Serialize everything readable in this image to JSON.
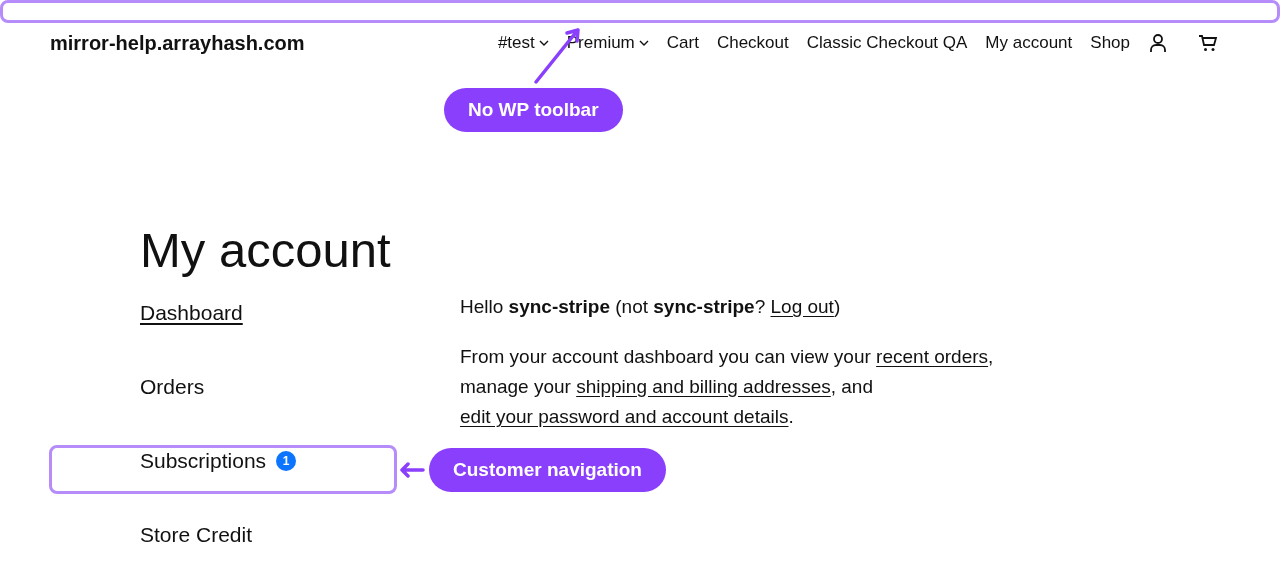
{
  "site_title": "mirror-help.arrayhash.com",
  "header_nav": [
    {
      "label": "#test",
      "kind": "dropdown"
    },
    {
      "label": "Premium",
      "kind": "dropdown"
    },
    {
      "label": "Cart",
      "kind": "link"
    },
    {
      "label": "Checkout",
      "kind": "link"
    },
    {
      "label": "Classic Checkout QA",
      "kind": "link"
    },
    {
      "label": "My account",
      "kind": "link"
    },
    {
      "label": "Shop",
      "kind": "link"
    }
  ],
  "page_title": "My account",
  "account_nav": [
    {
      "label": "Dashboard",
      "selected": true
    },
    {
      "label": "Orders",
      "selected": false
    },
    {
      "label": "Subscriptions",
      "selected": false,
      "badge": "1"
    },
    {
      "label": "Store Credit",
      "selected": false
    }
  ],
  "greeting": [
    {
      "text": "Hello ",
      "kind": "plain"
    },
    {
      "text": "sync-stripe",
      "kind": "bold"
    },
    {
      "text": " (not ",
      "kind": "plain"
    },
    {
      "text": "sync-stripe",
      "kind": "bold"
    },
    {
      "text": "? ",
      "kind": "plain"
    },
    {
      "text": "Log out",
      "kind": "link"
    },
    {
      "text": ")",
      "kind": "plain"
    }
  ],
  "intro": [
    {
      "text": "From your account dashboard you can view your ",
      "kind": "plain"
    },
    {
      "text": "recent orders",
      "kind": "link"
    },
    {
      "text": ", manage your ",
      "kind": "plain"
    },
    {
      "text": "shipping and billing addresses",
      "kind": "link"
    },
    {
      "text": ", and ",
      "kind": "plain"
    },
    {
      "text": "edit your password and account details",
      "kind": "link"
    },
    {
      "text": ".",
      "kind": "plain"
    }
  ],
  "annotations": [
    {
      "label": "No WP toolbar",
      "kind": "toolbar"
    },
    {
      "label": "Customer navigation",
      "kind": "navigation"
    }
  ]
}
